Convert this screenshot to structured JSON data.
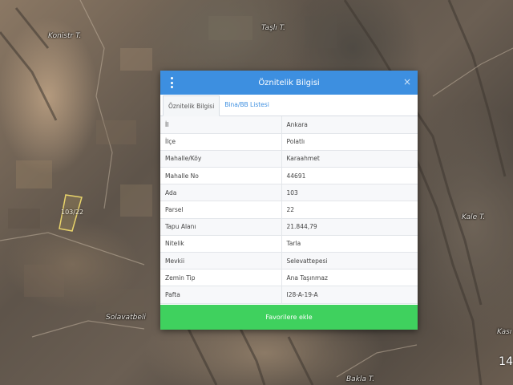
{
  "map": {
    "labels": [
      "Konistr T.",
      "Taşlı T.",
      "Kale T.",
      "Solavatbeli",
      "Bakla T.",
      "Kası"
    ],
    "parcel_label": "103/22",
    "corner_number": "14"
  },
  "modal": {
    "title": "Öznitelik Bilgisi",
    "close_symbol": "×",
    "tabs": [
      {
        "label": "Öznitelik Bilgisi",
        "active": true
      },
      {
        "label": "Bina/BB Listesi",
        "active": false
      }
    ],
    "rows": [
      {
        "key": "İl",
        "value": "Ankara"
      },
      {
        "key": "İlçe",
        "value": "Polatlı"
      },
      {
        "key": "Mahalle/Köy",
        "value": "Karaahmet"
      },
      {
        "key": "Mahalle No",
        "value": "44691"
      },
      {
        "key": "Ada",
        "value": "103"
      },
      {
        "key": "Parsel",
        "value": "22"
      },
      {
        "key": "Tapu Alanı",
        "value": "21.844,79"
      },
      {
        "key": "Nitelik",
        "value": "Tarla"
      },
      {
        "key": "Mevkii",
        "value": "Selevattepesi"
      },
      {
        "key": "Zemin Tip",
        "value": "Ana Taşınmaz"
      },
      {
        "key": "Pafta",
        "value": "I28-A-19-A"
      }
    ],
    "favorite_button": "Favorilere ekle"
  },
  "colors": {
    "header": "#3d8fe0",
    "button": "#3fd15e",
    "parcel_outline": "#e8d36a"
  },
  "icons": {
    "menu": "kebab-menu-icon",
    "close": "close-icon"
  }
}
